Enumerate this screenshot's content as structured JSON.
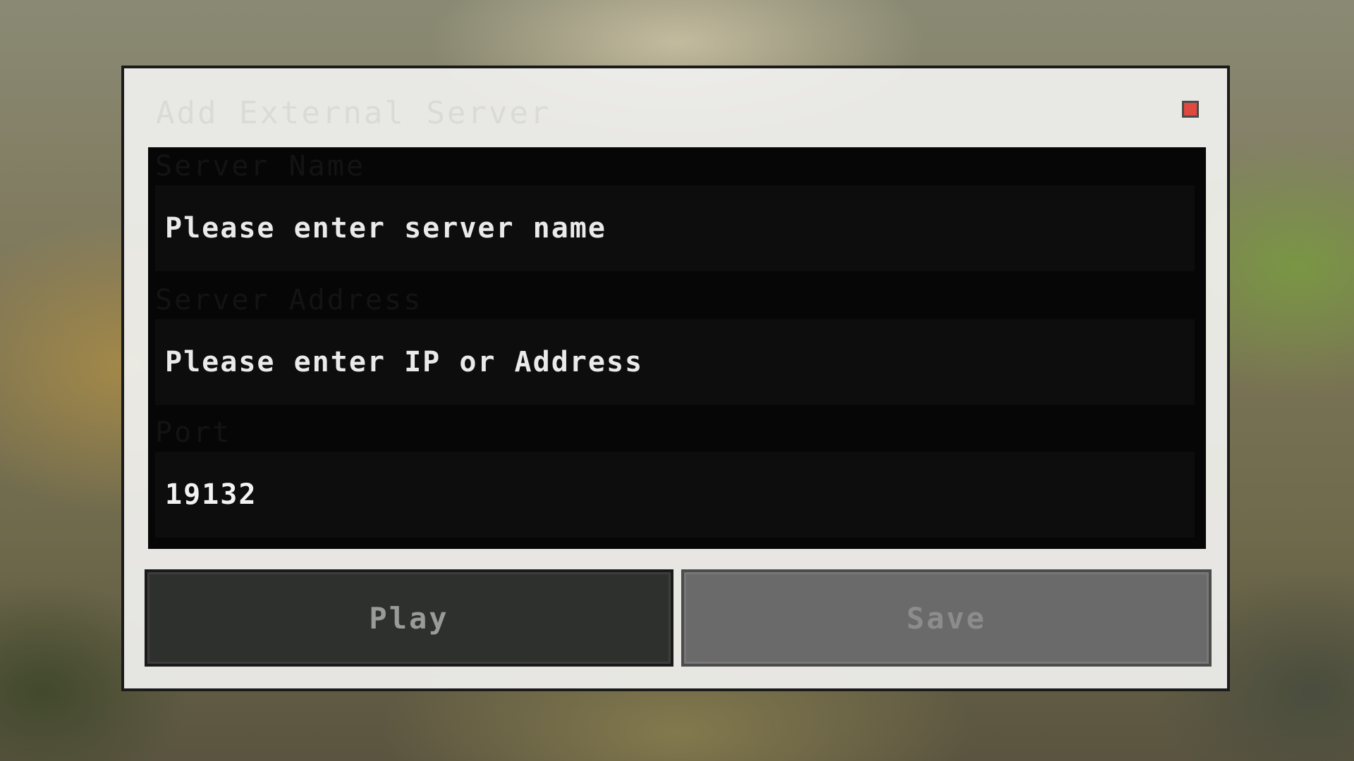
{
  "dialog": {
    "title": "Add External Server",
    "close_color": "#e0493f"
  },
  "fields": {
    "server_name": {
      "label": "Server Name",
      "value": "",
      "placeholder": "Please enter server name"
    },
    "server_address": {
      "label": "Server Address",
      "value": "",
      "placeholder": "Please enter IP or Address"
    },
    "port": {
      "label": "Port",
      "value": "19132",
      "placeholder": ""
    }
  },
  "buttons": {
    "play_label": "Play",
    "save_label": "Save"
  }
}
